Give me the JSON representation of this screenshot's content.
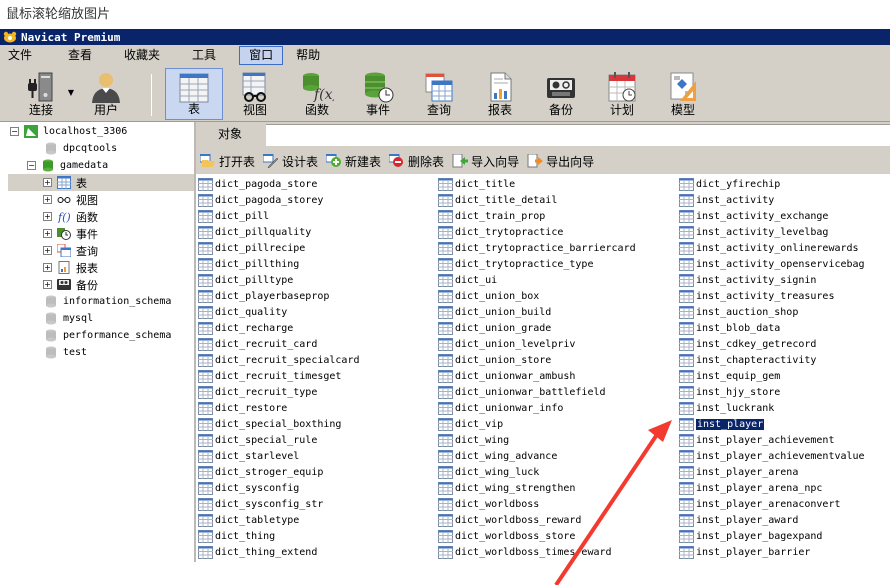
{
  "caption": "鼠标滚轮缩放图片",
  "window": {
    "title": "Navicat Premium"
  },
  "menu": [
    {
      "label": "文件"
    },
    {
      "label": "查看"
    },
    {
      "label": "收藏夹"
    },
    {
      "label": "工具"
    },
    {
      "label": "窗口",
      "active": true
    },
    {
      "label": "帮助"
    }
  ],
  "toolbar": {
    "connect": "连接",
    "user": "用户",
    "table": "表",
    "view": "视图",
    "function": "函数",
    "event": "事件",
    "query": "查询",
    "report": "报表",
    "backup": "备份",
    "schedule": "计划",
    "model": "模型"
  },
  "sidebar": {
    "connection": "localhost_3306",
    "databases": [
      {
        "name": "dpcqtools"
      },
      {
        "name": "gamedata",
        "expanded": true
      },
      {
        "name": "information_schema"
      },
      {
        "name": "mysql"
      },
      {
        "name": "performance_schema"
      },
      {
        "name": "test"
      }
    ],
    "gamedata_children": [
      {
        "label": "表",
        "selected": true
      },
      {
        "label": "视图"
      },
      {
        "label": "函数"
      },
      {
        "label": "事件"
      },
      {
        "label": "查询"
      },
      {
        "label": "报表"
      },
      {
        "label": "备份"
      }
    ]
  },
  "content": {
    "tab": "对象",
    "actions": {
      "open": "打开表",
      "design": "设计表",
      "new": "新建表",
      "delete": "删除表",
      "import": "导入向导",
      "export": "导出向导"
    },
    "columns": [
      [
        "dict_pagoda_store",
        "dict_pagoda_storey",
        "dict_pill",
        "dict_pillquality",
        "dict_pillrecipe",
        "dict_pillthing",
        "dict_pilltype",
        "dict_playerbaseprop",
        "dict_quality",
        "dict_recharge",
        "dict_recruit_card",
        "dict_recruit_specialcard",
        "dict_recruit_timesget",
        "dict_recruit_type",
        "dict_restore",
        "dict_special_boxthing",
        "dict_special_rule",
        "dict_starlevel",
        "dict_stroger_equip",
        "dict_sysconfig",
        "dict_sysconfig_str",
        "dict_tabletype",
        "dict_thing",
        "dict_thing_extend"
      ],
      [
        "dict_title",
        "dict_title_detail",
        "dict_train_prop",
        "dict_trytopractice",
        "dict_trytopractice_barriercard",
        "dict_trytopractice_type",
        "dict_ui",
        "dict_union_box",
        "dict_union_build",
        "dict_union_grade",
        "dict_union_levelpriv",
        "dict_union_store",
        "dict_unionwar_ambush",
        "dict_unionwar_battlefield",
        "dict_unionwar_info",
        "dict_vip",
        "dict_wing",
        "dict_wing_advance",
        "dict_wing_luck",
        "dict_wing_strengthen",
        "dict_worldboss",
        "dict_worldboss_reward",
        "dict_worldboss_store",
        "dict_worldboss_timesreward"
      ],
      [
        "dict_yfirechip",
        "inst_activity",
        "inst_activity_exchange",
        "inst_activity_levelbag",
        "inst_activity_onlinerewards",
        "inst_activity_openservicebag",
        "inst_activity_signin",
        "inst_activity_treasures",
        "inst_auction_shop",
        "inst_blob_data",
        "inst_cdkey_getrecord",
        "inst_chapteractivity",
        "inst_equip_gem",
        "inst_hjy_store",
        "inst_luckrank",
        "inst_player",
        "inst_player_achievement",
        "inst_player_achievementvalue",
        "inst_player_arena",
        "inst_player_arena_npc",
        "inst_player_arenaconvert",
        "inst_player_award",
        "inst_player_bagexpand",
        "inst_player_barrier"
      ]
    ],
    "selected_table": "inst_player"
  },
  "colors": {
    "titlebar": "#0a246a",
    "chrome": "#d4d0c8",
    "selection": "#0a246a",
    "annotation_arrow": "#f23a2f"
  }
}
